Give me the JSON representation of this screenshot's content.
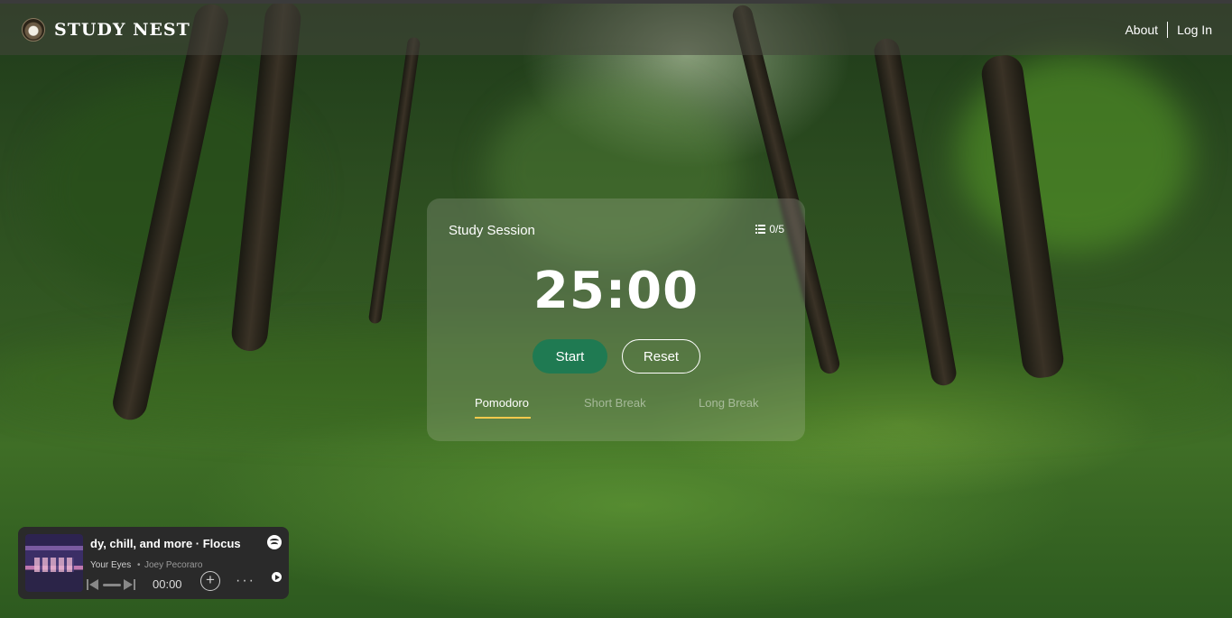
{
  "header": {
    "brand": "STUDY NEST",
    "nav": {
      "about": "About",
      "login": "Log In"
    }
  },
  "timer_card": {
    "title": "Study Session",
    "task_count": "0/5",
    "time": "25:00",
    "start_label": "Start",
    "reset_label": "Reset",
    "tabs": [
      {
        "label": "Pomodoro",
        "active": true
      },
      {
        "label": "Short Break",
        "active": false
      },
      {
        "label": "Long Break",
        "active": false
      }
    ],
    "accent_color": "#f2c94c",
    "start_color": "#1f7a52"
  },
  "player": {
    "title": "dy, chill, and more · Flocus",
    "song": "Your Eyes",
    "artist": "Joey Pecoraro",
    "time": "00:00",
    "icons": [
      "spotify-icon",
      "previous-icon",
      "next-icon",
      "add-icon",
      "more-icon",
      "play-icon"
    ]
  }
}
